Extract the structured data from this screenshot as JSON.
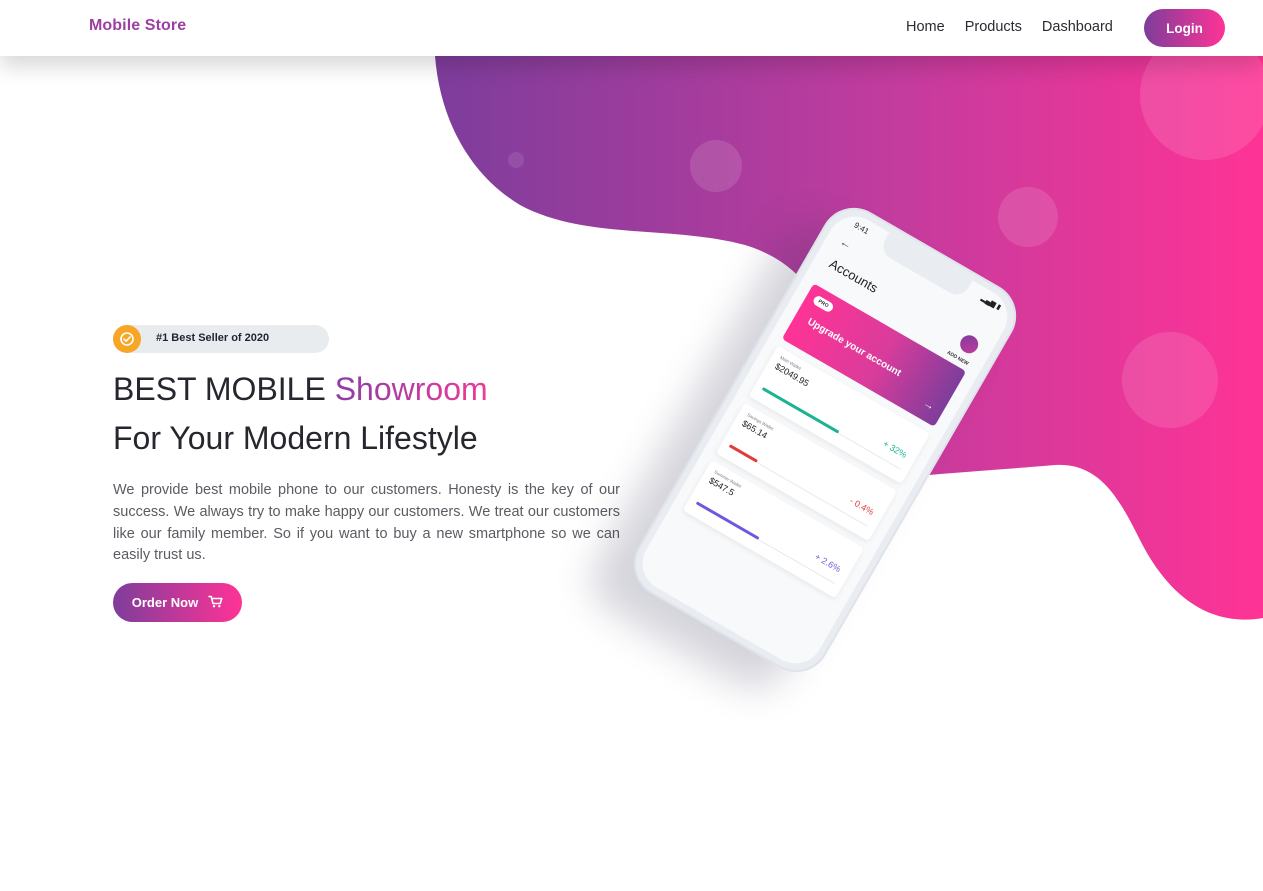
{
  "nav": {
    "brand": "Mobile Store",
    "links": [
      "Home",
      "Products",
      "Dashboard"
    ],
    "login_label": "Login"
  },
  "hero": {
    "badge": "#1 Best Seller of 2020",
    "title_line1_plain": "BEST MOBILE ",
    "title_line1_accent": "Showroom",
    "title_line2": "For Your Modern Lifestyle",
    "description": "We provide best mobile phone to our customers. Honesty is the key of our success. We always try to make happy our customers. We treat our customers like our family member. So if you want to buy a new smartphone so we can easily trust us.",
    "cta_label": "Order Now",
    "cta_icon": "cart-icon",
    "badge_icon": "check-badge-icon"
  },
  "phone": {
    "time": "9:41",
    "screen_title": "Accounts",
    "add_new": "ADD NEW",
    "pro_label": "PRO",
    "upgrade_text": "Upgrade your account",
    "wallets": [
      {
        "name": "Main Wallet",
        "amount": "$2049.95",
        "change": "+ 32%",
        "color": "#1ab394",
        "level": 0.55
      },
      {
        "name": "Savings Wallet",
        "amount": "$65.14",
        "change": "- 0.4%",
        "color": "#e23b3b",
        "level": 0.2
      },
      {
        "name": "Summer Wallet",
        "amount": "$547.5",
        "change": "+ 2.6%",
        "color": "#6b5ae0",
        "level": 0.45
      }
    ]
  },
  "colors": {
    "brand": "#9c3fa3",
    "gradient_start": "#7e3d9b",
    "gradient_end": "#ff3396",
    "badge_icon_bg": "#f7a626",
    "badge_bg": "#e8ecef"
  }
}
